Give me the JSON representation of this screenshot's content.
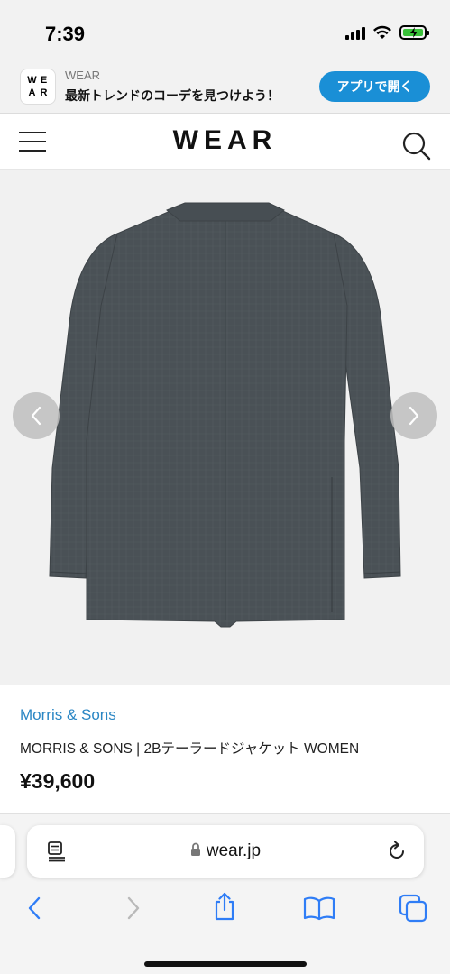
{
  "status_bar": {
    "time": "7:39"
  },
  "app_banner": {
    "logo_letters": [
      "W",
      "E",
      "A",
      "R"
    ],
    "app_name": "WEAR",
    "tagline": "最新トレンドのコーデを見つけよう！",
    "open_button_label": "アプリで開く"
  },
  "header": {
    "logo": "WEAR"
  },
  "product": {
    "brand": "Morris & Sons",
    "name": "MORRIS & SONS | 2Bテーラードジャケット WOMEN",
    "price": "¥39,600"
  },
  "browser": {
    "url": "wear.jp"
  },
  "colors": {
    "accent": "#1a8fd6",
    "brand_link": "#2a86c4",
    "safari_blue": "#2f7df6",
    "jacket": "#4a5156"
  }
}
